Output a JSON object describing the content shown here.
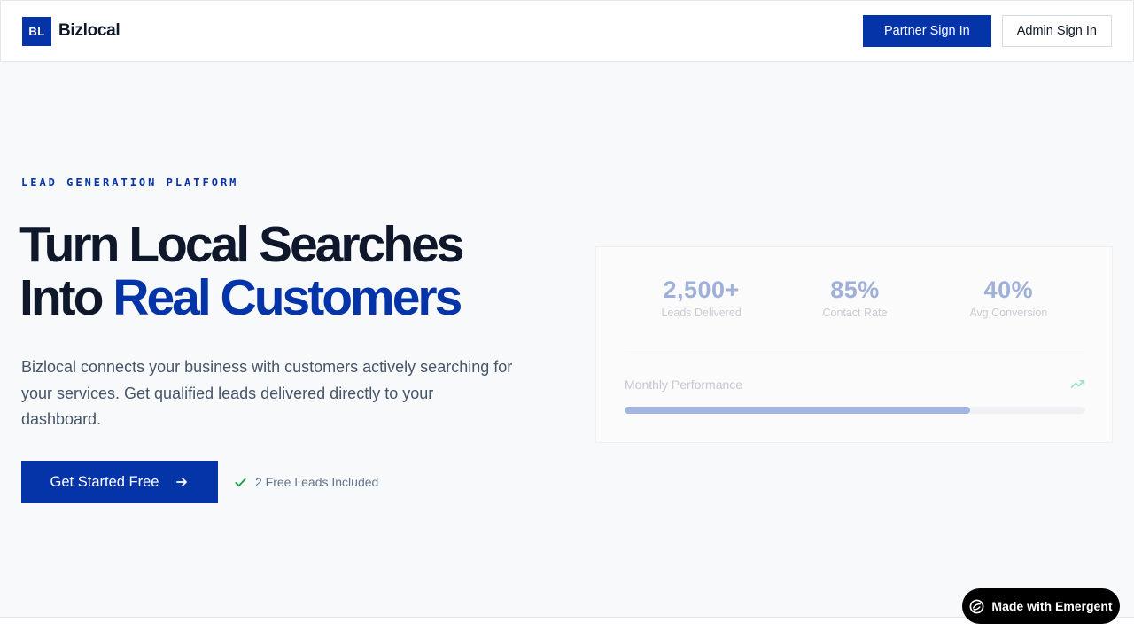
{
  "header": {
    "logo_mark": "BL",
    "brand_name": "Bizlocal",
    "partner_signin": "Partner Sign In",
    "admin_signin": "Admin Sign In"
  },
  "hero": {
    "eyebrow": "LEAD GENERATION PLATFORM",
    "headline_line1": "Turn Local Searches",
    "headline_line2_plain": "Into ",
    "headline_line2_accent": "Real Customers",
    "subtext": "Bizlocal connects your business with customers actively searching for your services. Get qualified leads delivered directly to your dashboard.",
    "cta_label": "Get Started Free",
    "cta_icon": "arrow-right-icon",
    "free_note": "2 Free Leads Included",
    "free_note_icon": "check-icon"
  },
  "stats_card": {
    "stats": [
      {
        "value": "2,500+",
        "label": "Leads Delivered"
      },
      {
        "value": "85%",
        "label": "Contact Rate"
      },
      {
        "value": "40%",
        "label": "Avg Conversion"
      }
    ],
    "performance_label": "Monthly Performance",
    "performance_icon": "trending-up-icon",
    "performance_progress": 0.75
  },
  "badge": {
    "label": "Made with Emergent",
    "icon": "emergent-logo-icon"
  },
  "colors": {
    "brand": "#0534a8",
    "background": "#f8f9fb",
    "text": "#0f172a",
    "muted": "#475569",
    "success": "#16a34a"
  }
}
